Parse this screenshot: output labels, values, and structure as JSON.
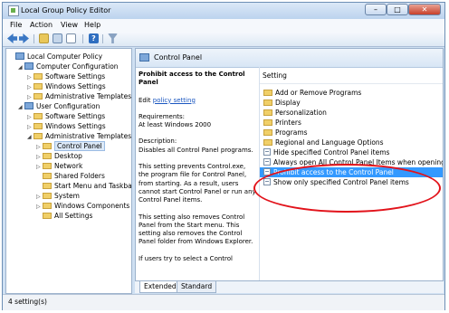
{
  "window": {
    "title": "Local Group Policy Editor",
    "min_glyph": "–",
    "max_glyph": "□",
    "close_glyph": "✕"
  },
  "menu": [
    "File",
    "Action",
    "View",
    "Help"
  ],
  "toolbar": {
    "help_glyph": "?"
  },
  "tree": [
    {
      "label": "Local Computer Policy",
      "indent": 0,
      "expander": "",
      "icon": "computer-icon"
    },
    {
      "label": "Computer Configuration",
      "indent": 1,
      "expander": "◢",
      "icon": "computer-icon"
    },
    {
      "label": "Software Settings",
      "indent": 2,
      "expander": "▷",
      "icon": "folder-icon"
    },
    {
      "label": "Windows Settings",
      "indent": 2,
      "expander": "▷",
      "icon": "folder-icon"
    },
    {
      "label": "Administrative Templates",
      "indent": 2,
      "expander": "▷",
      "icon": "folder-icon"
    },
    {
      "label": "User Configuration",
      "indent": 1,
      "expander": "◢",
      "icon": "computer-icon"
    },
    {
      "label": "Software Settings",
      "indent": 2,
      "expander": "▷",
      "icon": "folder-icon"
    },
    {
      "label": "Windows Settings",
      "indent": 2,
      "expander": "▷",
      "icon": "folder-icon"
    },
    {
      "label": "Administrative Templates",
      "indent": 2,
      "expander": "◢",
      "icon": "folder-icon"
    },
    {
      "label": "Control Panel",
      "indent": 3,
      "expander": "▷",
      "icon": "folder-icon",
      "selected": true
    },
    {
      "label": "Desktop",
      "indent": 3,
      "expander": "▷",
      "icon": "folder-icon"
    },
    {
      "label": "Network",
      "indent": 3,
      "expander": "▷",
      "icon": "folder-icon"
    },
    {
      "label": "Shared Folders",
      "indent": 3,
      "expander": "",
      "icon": "folder-icon"
    },
    {
      "label": "Start Menu and Taskbar",
      "indent": 3,
      "expander": "",
      "icon": "folder-icon"
    },
    {
      "label": "System",
      "indent": 3,
      "expander": "▷",
      "icon": "folder-icon"
    },
    {
      "label": "Windows Components",
      "indent": 3,
      "expander": "▷",
      "icon": "folder-icon"
    },
    {
      "label": "All Settings",
      "indent": 3,
      "expander": "",
      "icon": "folder-icon"
    }
  ],
  "header": {
    "title": "Control Panel"
  },
  "description": {
    "policy_title": "Prohibit access to the Control Panel",
    "edit_prefix": "Edit ",
    "edit_link": "policy setting",
    "requirements": "Requirements:\nAt least Windows 2000",
    "description": "Description:\nDisables all Control Panel programs.",
    "para1": "This setting prevents Control.exe, the program file for Control Panel, from starting. As a result, users cannot start Control Panel or run any Control Panel items.",
    "para2": "This setting also removes Control Panel from the Start menu. This setting also removes the Control Panel folder from Windows Explorer.",
    "para3": "If users try to select a Control"
  },
  "list": {
    "column": "Setting",
    "rows": [
      {
        "label": "Add or Remove Programs",
        "kind": "folder"
      },
      {
        "label": "Display",
        "kind": "folder"
      },
      {
        "label": "Personalization",
        "kind": "folder"
      },
      {
        "label": "Printers",
        "kind": "folder"
      },
      {
        "label": "Programs",
        "kind": "folder"
      },
      {
        "label": "Regional and Language Options",
        "kind": "folder"
      },
      {
        "label": "Hide specified Control Panel items",
        "kind": "policy"
      },
      {
        "label": "Always open All Control Panel Items when opening Control Panel",
        "kind": "policy"
      },
      {
        "label": "Prohibit access to the Control Panel",
        "kind": "policy",
        "selected": true
      },
      {
        "label": "Show only specified Control Panel items",
        "kind": "policy"
      }
    ]
  },
  "tabs": [
    "Extended",
    "Standard"
  ],
  "status": {
    "text": "4 setting(s)"
  },
  "colors": {
    "selection": "#3399ff",
    "annotation_ring": "#e2131b"
  }
}
